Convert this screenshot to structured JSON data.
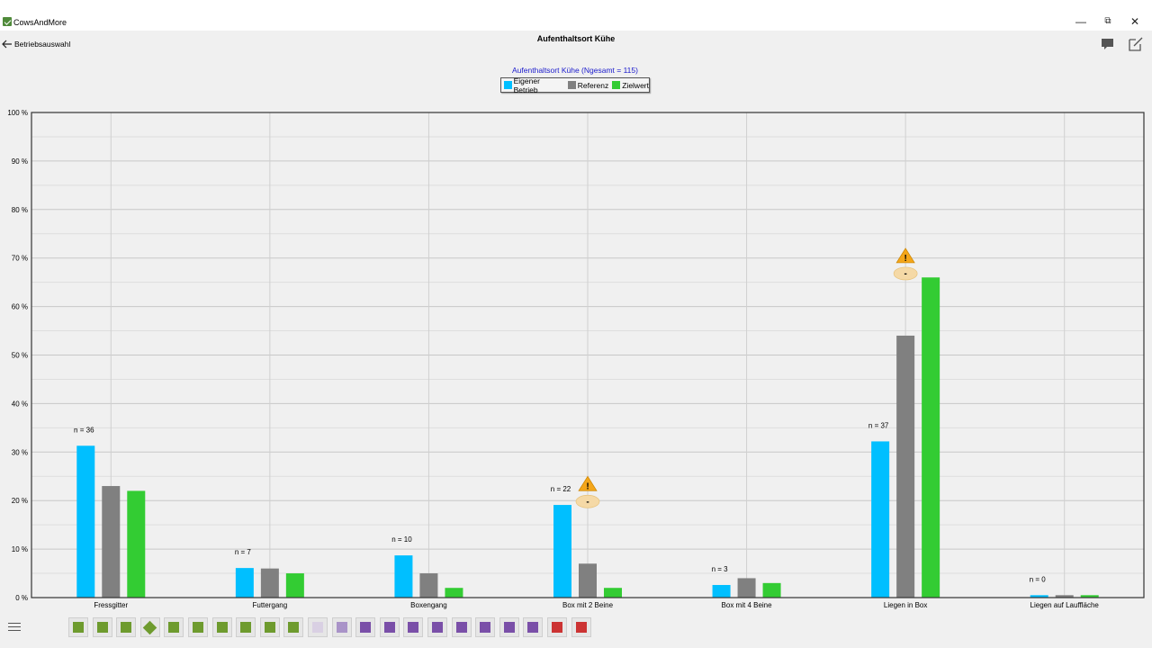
{
  "app": {
    "title": "CowsAndMore"
  },
  "window_controls": {
    "minimize": "—",
    "restore": "⧉",
    "close": "✕"
  },
  "header": {
    "back_label": "Betriebsauswahl",
    "title": "Aufenthaltsort Kühe"
  },
  "colors": {
    "eigener": "#00bfff",
    "referenz": "#808080",
    "zielwert": "#33cc33",
    "warning": "#f4a61a",
    "warning_badge": "#f5d9a6"
  },
  "chart_data": {
    "type": "bar",
    "title": "Aufenthaltsort Kühe  (Ngesamt = 115)",
    "categories": [
      "Fressgitter",
      "Futtergang",
      "Boxengang",
      "Box mit 2 Beine",
      "Box mit 4 Beine",
      "Liegen in Box",
      "Liegen auf Lauffläche"
    ],
    "series": [
      {
        "name": "Eigener Betrieb",
        "values": [
          31.3,
          6.1,
          8.7,
          19.1,
          2.6,
          32.2,
          0.5
        ]
      },
      {
        "name": "Referenz",
        "values": [
          23,
          6,
          5,
          7,
          4,
          54,
          0.5
        ]
      },
      {
        "name": "Zielwert",
        "values": [
          22,
          5,
          2,
          2,
          3,
          66,
          0.5
        ]
      }
    ],
    "n_labels": [
      "n = 36",
      "n = 7",
      "n = 10",
      "n = 22",
      "n = 3",
      "n = 37",
      "n = 0"
    ],
    "warnings": [
      {
        "category": "Box mit 2 Beine",
        "symbol": "!",
        "badge": "-"
      },
      {
        "category": "Liegen in Box",
        "symbol": "!",
        "badge": "-"
      }
    ],
    "ylim": [
      0,
      100
    ],
    "yticks": [
      0,
      10,
      20,
      30,
      40,
      50,
      60,
      70,
      80,
      90,
      100
    ],
    "ytick_labels": [
      "0 %",
      "10 %",
      "20 %",
      "30 %",
      "40 %",
      "50 %",
      "60 %",
      "70 %",
      "80 %",
      "90 %",
      "100 %"
    ],
    "grid": true,
    "legend_position": "top-center"
  },
  "bottom_nav": {
    "tiles": [
      {
        "color": "#6e9b2e",
        "shape": "square"
      },
      {
        "color": "#6e9b2e",
        "shape": "square"
      },
      {
        "color": "#6e9b2e",
        "shape": "square"
      },
      {
        "color": "#6e9b2e",
        "shape": "diamond",
        "selected": true
      },
      {
        "color": "#6e9b2e",
        "shape": "square"
      },
      {
        "color": "#6e9b2e",
        "shape": "square"
      },
      {
        "color": "#6e9b2e",
        "shape": "square"
      },
      {
        "color": "#6e9b2e",
        "shape": "square"
      },
      {
        "color": "#6e9b2e",
        "shape": "square"
      },
      {
        "color": "#6e9b2e",
        "shape": "square"
      },
      {
        "color": "#d9d0e3",
        "shape": "square"
      },
      {
        "color": "#a993c8",
        "shape": "square"
      },
      {
        "color": "#7a4fa8",
        "shape": "square"
      },
      {
        "color": "#7a4fa8",
        "shape": "square"
      },
      {
        "color": "#7a4fa8",
        "shape": "square"
      },
      {
        "color": "#7a4fa8",
        "shape": "square"
      },
      {
        "color": "#7a4fa8",
        "shape": "square"
      },
      {
        "color": "#7a4fa8",
        "shape": "square"
      },
      {
        "color": "#7a4fa8",
        "shape": "square"
      },
      {
        "color": "#7a4fa8",
        "shape": "square"
      },
      {
        "color": "#cc3333",
        "shape": "square"
      },
      {
        "color": "#cc3333",
        "shape": "square"
      }
    ]
  }
}
